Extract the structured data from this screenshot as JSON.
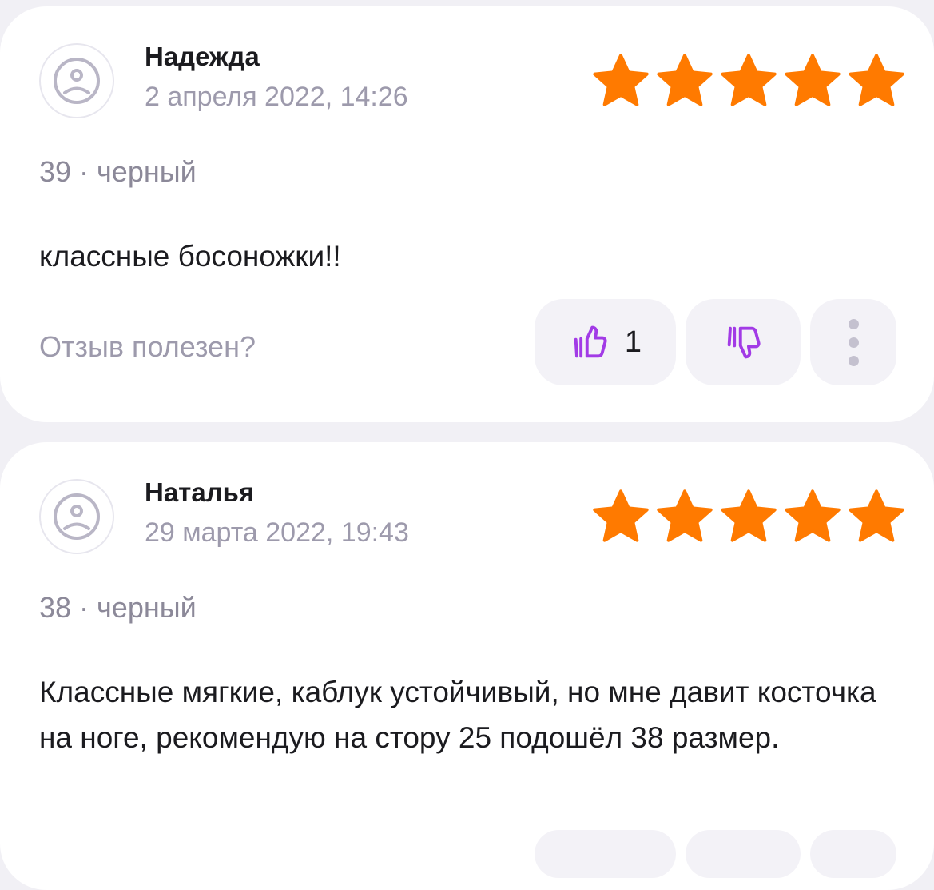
{
  "colors": {
    "background": "#f1f0f5",
    "card": "#ffffff",
    "star": "#ff7a00",
    "accent": "#a23be6",
    "muted_text": "#9d9aac",
    "primary_text": "#1b1b1f"
  },
  "icons": {
    "avatar": "sad-face-icon",
    "star": "star-icon",
    "like": "thumbs-up-icon",
    "dislike": "thumbs-down-icon",
    "more": "more-vertical-icon"
  },
  "reviews": [
    {
      "author": "Надежда",
      "date": "2 апреля 2022, 14:26",
      "rating": 5,
      "meta": "39 · черный",
      "text": "классные босоножки!!",
      "useful_label": "Отзыв полезен?",
      "likes": "1"
    },
    {
      "author": "Наталья",
      "date": "29 марта 2022, 19:43",
      "rating": 5,
      "meta": "38 · черный",
      "text": "Классные мягкие, каблук устойчивый, но мне давит косточка на ноге, рекомендую на стору 25 подошёл 38 размер."
    }
  ]
}
